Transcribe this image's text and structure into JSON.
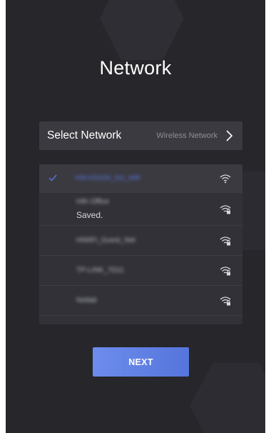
{
  "page": {
    "title": "Network"
  },
  "select_network": {
    "label": "Select Network",
    "value": "Wireless Network"
  },
  "networks": [
    {
      "name": "HIKVISION_5G_Wifi",
      "status": "",
      "locked": false,
      "selected": true
    },
    {
      "name": "HIK-Office",
      "status": "Saved.",
      "locked": true,
      "selected": false
    },
    {
      "name": "HiWiFi_Guest_Net",
      "status": "",
      "locked": true,
      "selected": false
    },
    {
      "name": "TP-LINK_7D11",
      "status": "",
      "locked": true,
      "selected": false
    },
    {
      "name": "Netlab",
      "status": "",
      "locked": true,
      "selected": false
    }
  ],
  "buttons": {
    "next": "NEXT"
  },
  "colors": {
    "background": "#26262b",
    "accent": "#5b77e0",
    "button": "#6080e4"
  }
}
